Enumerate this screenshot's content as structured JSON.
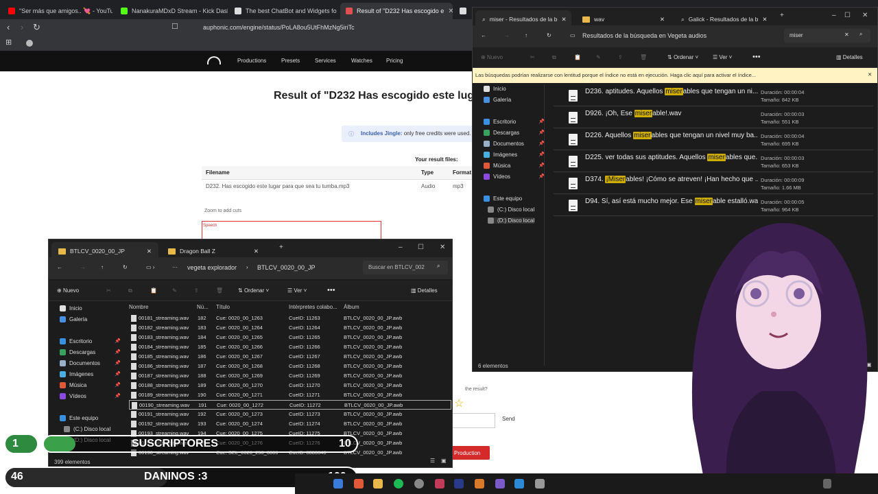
{
  "browser": {
    "tabs": [
      {
        "label": "\"Ser más que amigos.. 💘 - YouTube",
        "color": "#ff0000"
      },
      {
        "label": "NanakuraMDxD Stream - Kick Dashb",
        "color": "#53fc18"
      },
      {
        "label": "The best ChatBot and Widgets fo",
        "color": "#dddddd"
      },
      {
        "label": "Result of \"D232 Has escogido e",
        "color": "#e05050"
      },
      {
        "label": "a",
        "color": "#dddddd"
      }
    ],
    "url": "auphonic.com/engine/status/PoLA8ou5UtFhMzNg5iriTc"
  },
  "site": {
    "nav": [
      "Productions",
      "Presets",
      "Services",
      "Watches",
      "Pricing"
    ],
    "title": "Result of \"D232 Has escogido este luga",
    "jingle_label": "Includes Jingle:",
    "jingle_text": "only free credits were used.",
    "result_files": "Your result files:",
    "table_headers": [
      "Filename",
      "Type",
      "Format"
    ],
    "table_row": [
      "D232. Has escogido este lugar para que sea tu tumba.mp3",
      "Audio",
      "mp3"
    ],
    "zoom": "Zoom to add cuts",
    "speech": "Speech",
    "rate": "the result?",
    "send": "Send",
    "production": "Production"
  },
  "search_window": {
    "tabs": [
      "miser - Resultados de la b",
      "wav",
      "Galick - Resultados de la b"
    ],
    "path": "Resultados de la búsqueda en Vegeta audios",
    "search_value": "miser",
    "toolbar": {
      "new": "Nuevo",
      "sort": "Ordenar",
      "view": "Ver",
      "details": "Detalles"
    },
    "infobar": "Las búsquedas podrían realizarse con lentitud porque el índice no está en ejecución. Haga clic aquí para activar el índice...",
    "sidebar": [
      "Inicio",
      "Galería",
      "Escritorio",
      "Descargas",
      "Documentos",
      "Imágenes",
      "Música",
      "Vídeos",
      "Este equipo",
      "(C:) Disco local",
      "(D:) Disco local"
    ],
    "results": [
      {
        "pre": "D236. aptitudes. Aquellos ",
        "hl": "miser",
        "post": "ables que tengan un ni...",
        "dur": "Duración: 00:00:04",
        "size": "Tamaño: 842 KB"
      },
      {
        "pre": "D926. ¡Oh, Ese ",
        "hl": "miser",
        "post": "able!.wav",
        "dur": "Duración: 00:00:03",
        "size": "Tamaño: 551 KB"
      },
      {
        "pre": "D226. Aquellos ",
        "hl": "miser",
        "post": "ables que tengan un nivel muy ba...",
        "dur": "Duración: 00:00:04",
        "size": "Tamaño: 695 KB"
      },
      {
        "pre": "D225. ver todas sus aptitudes. Aquellos ",
        "hl": "miser",
        "post": "ables que...",
        "dur": "Duración: 00:00:03",
        "size": "Tamaño: 653 KB"
      },
      {
        "pre": "D374. ",
        "hl": "¡Miser",
        "post": "ables! ¡Cómo se atreven! ¡Han hecho que ...",
        "dur": "Duración: 00:00:09",
        "size": "Tamaño: 1.66 MB"
      },
      {
        "pre": "D94. Sí, así está mucho mejor. Ese ",
        "hl": "miser",
        "post": "able estalló.wav",
        "dur": "Duración: 00:00:05",
        "size": "Tamaño: 964 KB"
      }
    ],
    "status": "6 elementos"
  },
  "files_window": {
    "tabs": [
      "BTLCV_0020_00_JP",
      "Dragon Ball Z"
    ],
    "breadcrumb": [
      "vegeta explorador",
      "BTLCV_0020_00_JP"
    ],
    "search_placeholder": "Buscar en BTLCV_002",
    "toolbar": {
      "new": "Nuevo",
      "sort": "Ordenar",
      "view": "Ver",
      "details": "Detalles"
    },
    "sidebar": [
      "Inicio",
      "Galería",
      "Escritorio",
      "Descargas",
      "Documentos",
      "Imágenes",
      "Música",
      "Vídeos",
      "Este equipo",
      "(C:) Disco local",
      "(D:) Disco local"
    ],
    "columns": [
      "Nombre",
      "Nú...",
      "Título",
      "Intérpretes colabo...",
      "Álbum"
    ],
    "rows": [
      [
        "00181_streaming.wav",
        "182",
        "Cue: 0020_00_1263",
        "CueID: 11263",
        "BTLCV_0020_00_JP.awb"
      ],
      [
        "00182_streaming.wav",
        "183",
        "Cue: 0020_00_1264",
        "CueID: 11264",
        "BTLCV_0020_00_JP.awb"
      ],
      [
        "00183_streaming.wav",
        "184",
        "Cue: 0020_00_1265",
        "CueID: 11265",
        "BTLCV_0020_00_JP.awb"
      ],
      [
        "00184_streaming.wav",
        "185",
        "Cue: 0020_00_1266",
        "CueID: 11266",
        "BTLCV_0020_00_JP.awb"
      ],
      [
        "00185_streaming.wav",
        "186",
        "Cue: 0020_00_1267",
        "CueID: 11267",
        "BTLCV_0020_00_JP.awb"
      ],
      [
        "00186_streaming.wav",
        "187",
        "Cue: 0020_00_1268",
        "CueID: 11268",
        "BTLCV_0020_00_JP.awb"
      ],
      [
        "00187_streaming.wav",
        "188",
        "Cue: 0020_00_1269",
        "CueID: 11269",
        "BTLCV_0020_00_JP.awb"
      ],
      [
        "00188_streaming.wav",
        "189",
        "Cue: 0020_00_1270",
        "CueID: 11270",
        "BTLCV_0020_00_JP.awb"
      ],
      [
        "00189_streaming.wav",
        "190",
        "Cue: 0020_00_1271",
        "CueID: 11271",
        "BTLCV_0020_00_JP.awb"
      ],
      [
        "00190_streaming.wav",
        "191",
        "Cue: 0020_00_1272",
        "CueID: 11272",
        "BTLCV_0020_00_JP.awb"
      ],
      [
        "00191_streaming.wav",
        "192",
        "Cue: 0020_00_1273",
        "CueID: 11273",
        "BTLCV_0020_00_JP.awb"
      ],
      [
        "00192_streaming.wav",
        "193",
        "Cue: 0020_00_1274",
        "CueID: 11274",
        "BTLCV_0020_00_JP.awb"
      ],
      [
        "00193_streaming.wav",
        "194",
        "Cue: 0020_00_1275",
        "CueID: 11275",
        "BTLCV_0020_00_JP.awb"
      ],
      [
        "00194_streaming.wav",
        "195",
        "Cue: 0020_00_1276",
        "CueID: 11276",
        "BTLCV_0020_00_JP.awb"
      ],
      [
        "00196_streaming.wav",
        "",
        "Cue: SEL_0020_250_0000",
        "CueID: 8880040",
        "BTLCV_0020_00_JP.awb"
      ]
    ],
    "selected_row": 9,
    "status": "399 elementos"
  },
  "overlay": {
    "subs_count": "1",
    "subs_label": "SUSCRIPTORES",
    "subs_goal": "10",
    "bottom_count": "46",
    "bottom_label": "DANINOS :3",
    "bottom_goal": "100",
    "subs_progress": 0.1,
    "bottom_progress": 0.46
  },
  "colors": {
    "accent_highlight": "#cfae00",
    "auphonic_red": "#d42a2a",
    "overlay_green": "#3aa04a"
  }
}
